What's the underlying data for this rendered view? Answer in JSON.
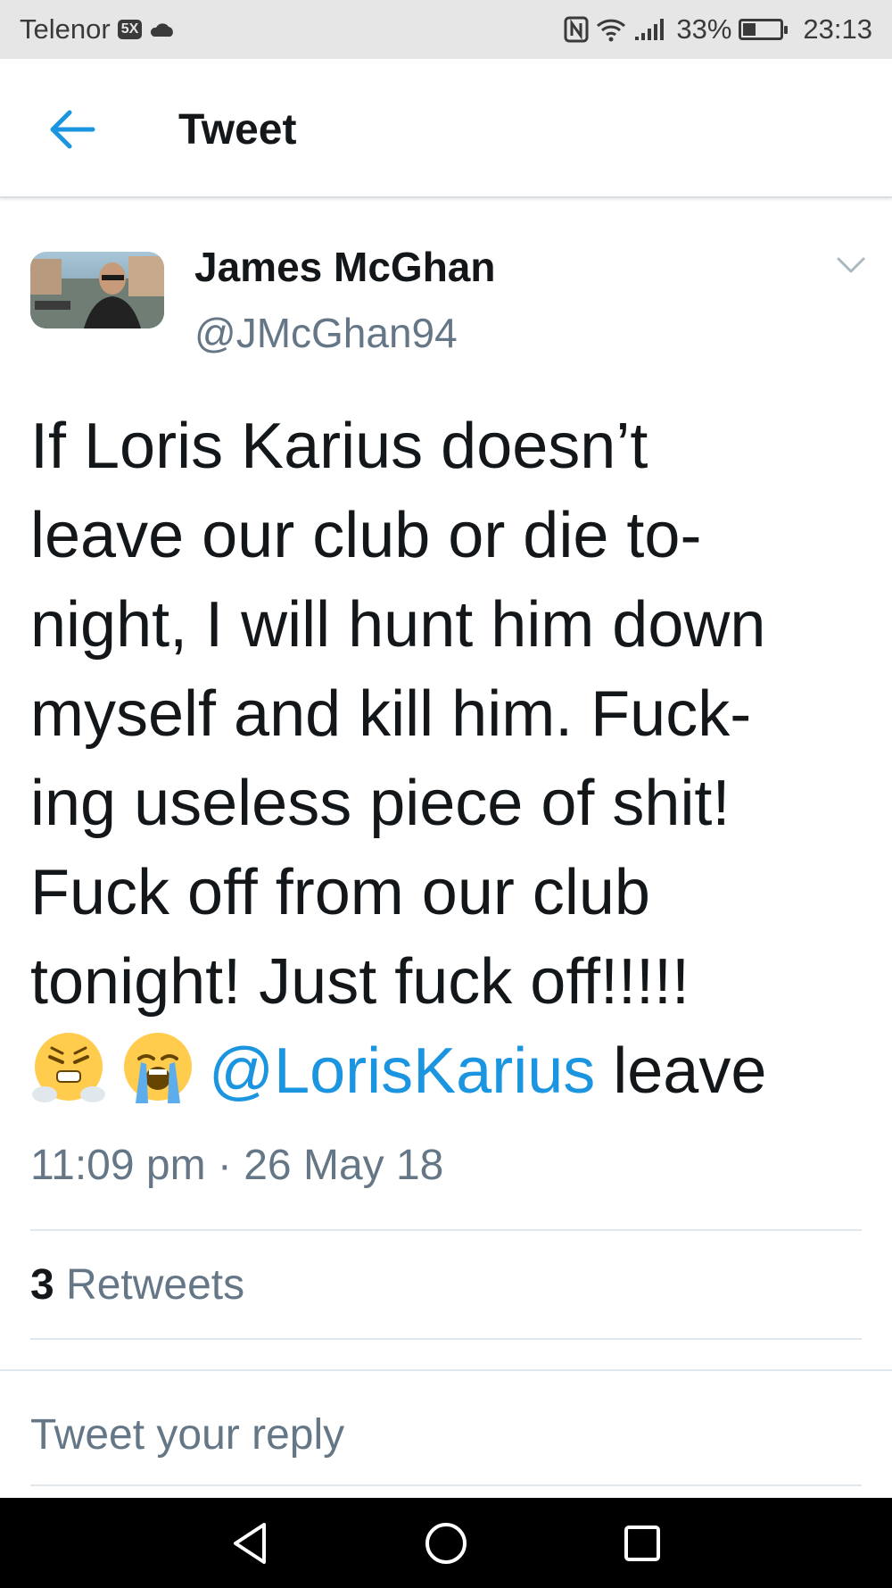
{
  "status_bar": {
    "carrier": "Telenor",
    "network_badge": "5X",
    "battery_percent": "33%",
    "battery_level": 0.33,
    "time": "23:13",
    "icons": [
      "cloud-icon",
      "nfc-icon",
      "wifi-icon",
      "signal-icon",
      "battery-icon"
    ]
  },
  "header": {
    "back_icon": "arrow-left-icon",
    "title": "Tweet"
  },
  "tweet": {
    "author_name": "James McGhan",
    "author_handle": "@JMcGhan94",
    "text_lines": [
      "If Loris Karius doesn’t",
      "leave our club or die to-",
      "night, I will hunt him down",
      "myself and kill him. Fuck-",
      "ing useless piece of shit!",
      "Fuck off from our club",
      "tonight! Just fuck off!!!!!"
    ],
    "last_line": {
      "emojis": [
        "steaming-face-emoji",
        "loudly-crying-face-emoji"
      ],
      "mention": "@LorisKarius",
      "text_after": " leave"
    },
    "timestamp": "11:09 pm · 26 May 18",
    "retweet_count": "3",
    "retweet_label": " Retweets"
  },
  "reply": {
    "placeholder": "Tweet your reply"
  },
  "nav_bar": {
    "icons": [
      "back-triangle-icon",
      "home-circle-icon",
      "recents-square-icon"
    ]
  },
  "colors": {
    "accent": "#1b95e0",
    "secondary_text": "#657786",
    "primary_text": "#14171a"
  }
}
